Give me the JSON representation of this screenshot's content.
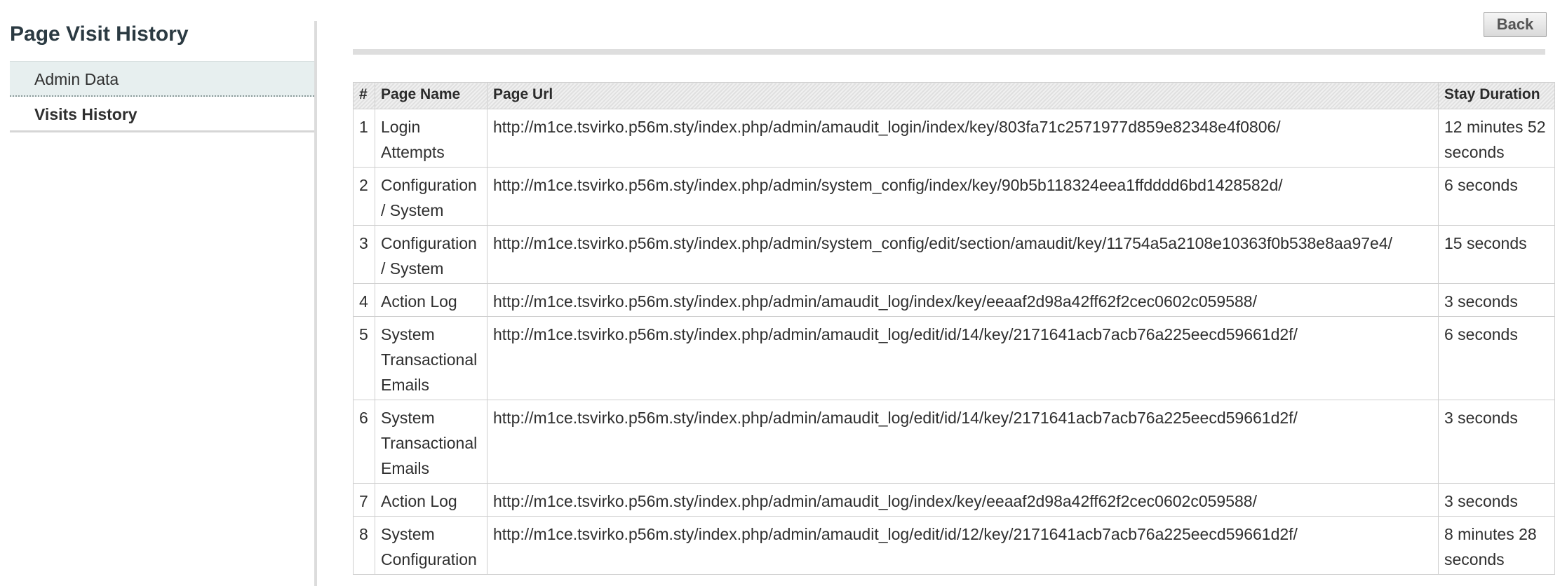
{
  "sidebar": {
    "title": "Page Visit History",
    "tabs": [
      {
        "label": "Admin Data"
      },
      {
        "label": "Visits History"
      }
    ]
  },
  "toolbar": {
    "back_label": "Back"
  },
  "table": {
    "columns": [
      "#",
      "Page Name",
      "Page Url",
      "Stay Duration"
    ],
    "rows": [
      {
        "num": "1",
        "name": "Login Attempts",
        "url": "http://m1ce.tsvirko.p56m.sty/index.php/admin/amaudit_login/index/key/803fa71c2571977d859e82348e4f0806/",
        "duration": "12 minutes 52 seconds"
      },
      {
        "num": "2",
        "name": "Configuration / System",
        "url": "http://m1ce.tsvirko.p56m.sty/index.php/admin/system_config/index/key/90b5b118324eea1ffdddd6bd1428582d/",
        "duration": "6 seconds"
      },
      {
        "num": "3",
        "name": "Configuration / System",
        "url": "http://m1ce.tsvirko.p56m.sty/index.php/admin/system_config/edit/section/amaudit/key/11754a5a2108e10363f0b538e8aa97e4/",
        "duration": "15 seconds"
      },
      {
        "num": "4",
        "name": "Action Log",
        "url": "http://m1ce.tsvirko.p56m.sty/index.php/admin/amaudit_log/index/key/eeaaf2d98a42ff62f2cec0602c059588/",
        "duration": "3 seconds"
      },
      {
        "num": "5",
        "name": "System Transactional Emails",
        "url": "http://m1ce.tsvirko.p56m.sty/index.php/admin/amaudit_log/edit/id/14/key/2171641acb7acb76a225eecd59661d2f/",
        "duration": "6 seconds"
      },
      {
        "num": "6",
        "name": "System Transactional Emails",
        "url": "http://m1ce.tsvirko.p56m.sty/index.php/admin/amaudit_log/edit/id/14/key/2171641acb7acb76a225eecd59661d2f/",
        "duration": "3 seconds"
      },
      {
        "num": "7",
        "name": "Action Log",
        "url": "http://m1ce.tsvirko.p56m.sty/index.php/admin/amaudit_log/index/key/eeaaf2d98a42ff62f2cec0602c059588/",
        "duration": "3 seconds"
      },
      {
        "num": "8",
        "name": "System Configuration",
        "url": "http://m1ce.tsvirko.p56m.sty/index.php/admin/amaudit_log/edit/id/12/key/2171641acb7acb76a225eecd59661d2f/",
        "duration": "8 minutes 28 seconds"
      }
    ]
  }
}
